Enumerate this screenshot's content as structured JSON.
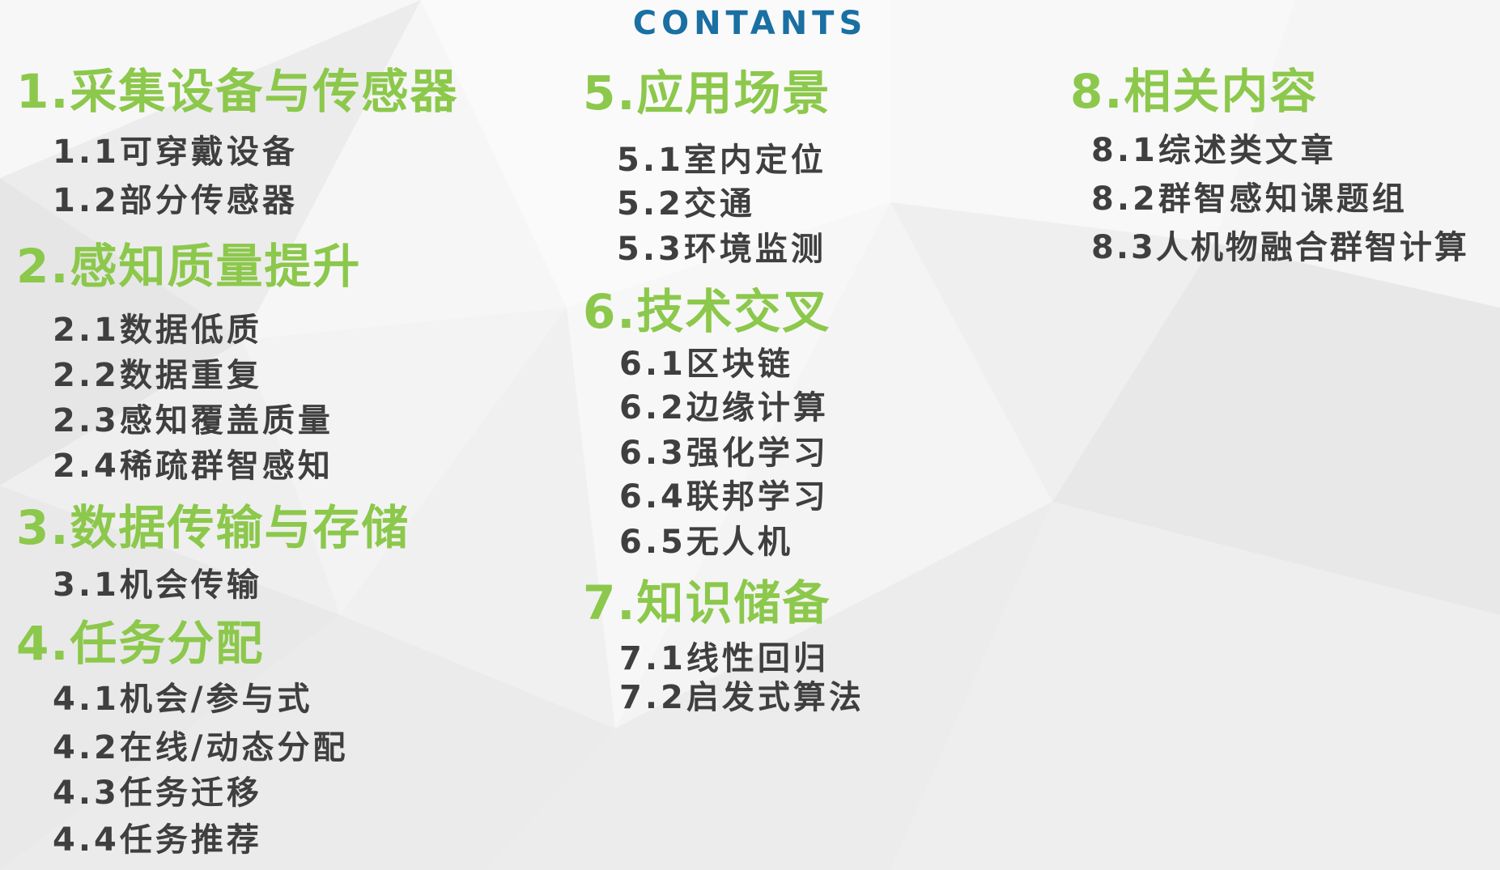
{
  "page": {
    "title": "CONTANTS"
  },
  "colors": {
    "heading": "#8cc84b",
    "item": "#3f3f3f",
    "title": "#1a6fa3",
    "background": "#f2f2f2"
  },
  "sections": [
    {
      "heading": "1.采集设备与传感器",
      "items": [
        "1.1可穿戴设备",
        "1.2部分传感器"
      ]
    },
    {
      "heading": "2.感知质量提升",
      "items": [
        "2.1数据低质",
        "2.2数据重复",
        "2.3感知覆盖质量",
        "2.4稀疏群智感知"
      ]
    },
    {
      "heading": "3.数据传输与存储",
      "items": [
        "3.1机会传输"
      ]
    },
    {
      "heading": "4.任务分配",
      "items": [
        "4.1机会/参与式",
        "4.2在线/动态分配",
        "4.3任务迁移",
        "4.4任务推荐"
      ]
    },
    {
      "heading": "5.应用场景",
      "items": [
        "5.1室内定位",
        "5.2交通",
        "5.3环境监测"
      ]
    },
    {
      "heading": "6.技术交叉",
      "items": [
        "6.1区块链",
        "6.2边缘计算",
        "6.3强化学习",
        "6.4联邦学习",
        "6.5无人机"
      ]
    },
    {
      "heading": "7.知识储备",
      "items": [
        "7.1线性回归",
        "7.2启发式算法"
      ]
    },
    {
      "heading": "8.相关内容",
      "items": [
        "8.1综述类文章",
        "8.2群智感知课题组",
        "8.3人机物融合群智计算"
      ]
    }
  ]
}
